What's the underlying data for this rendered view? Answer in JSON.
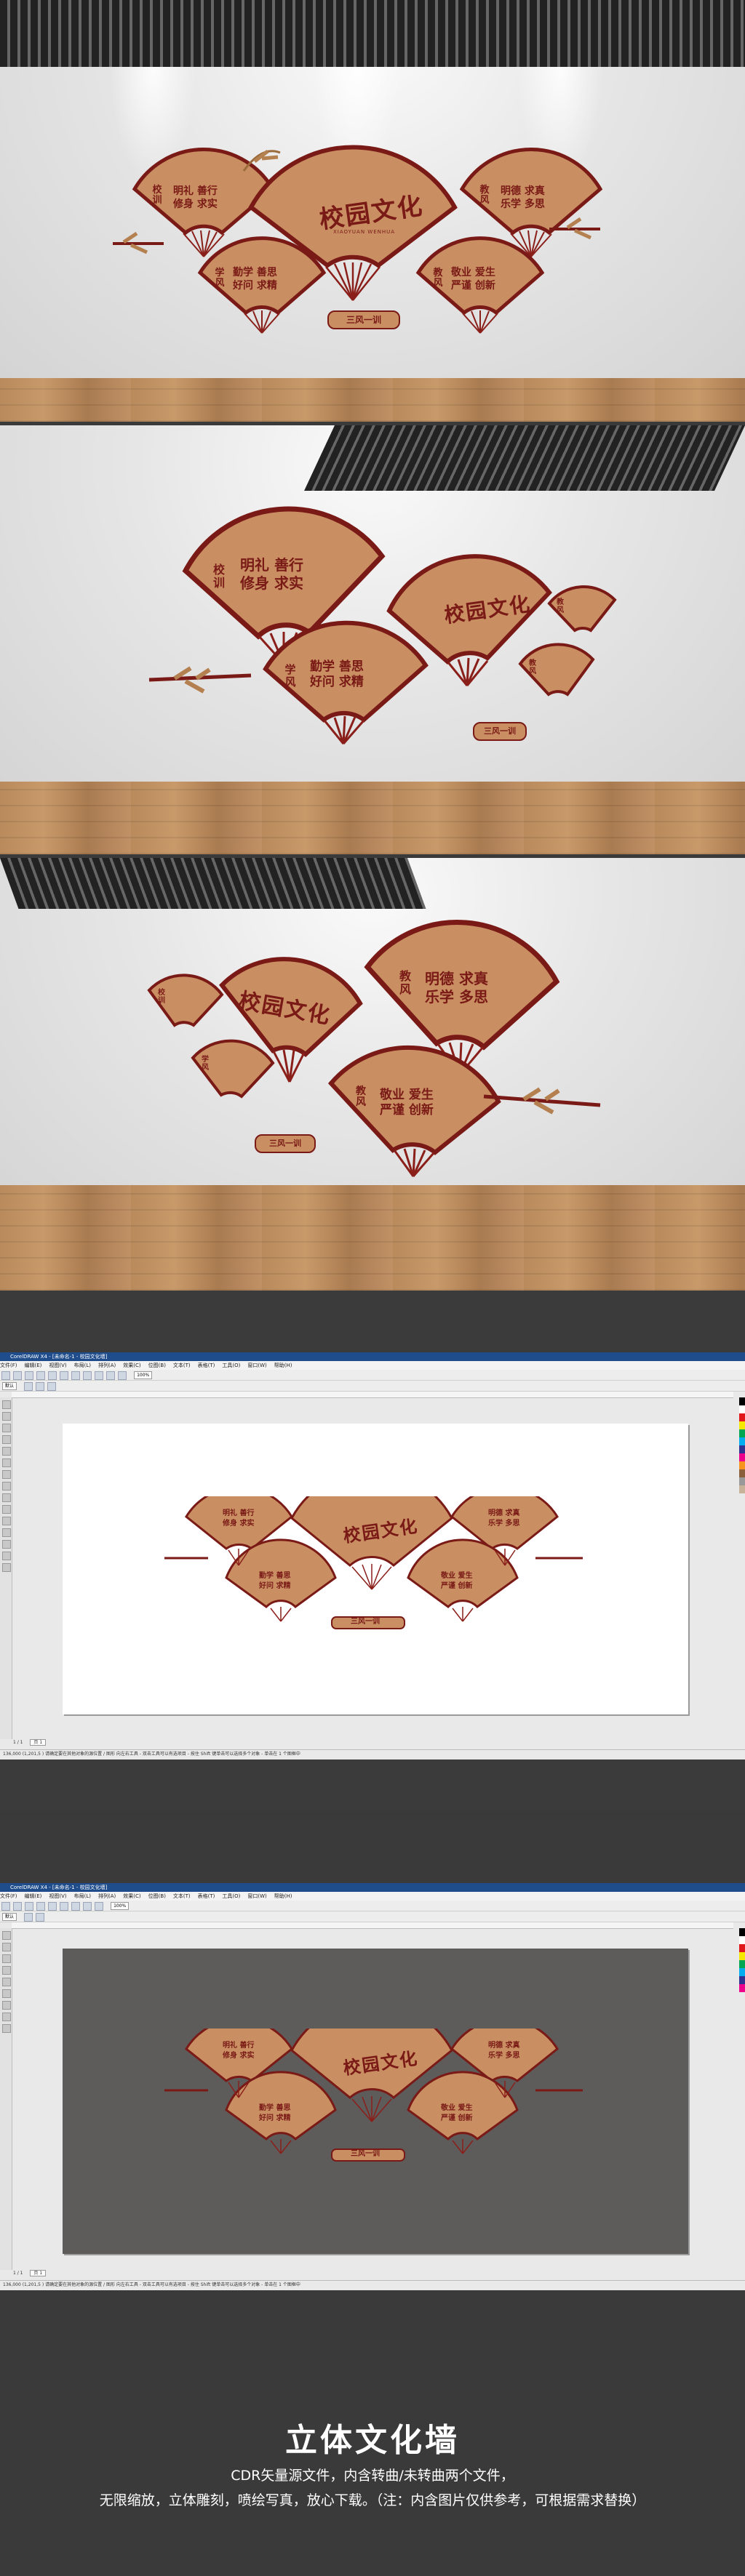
{
  "wall": {
    "title": "校园文化",
    "subtitle": "XIAOYUAN WENHUA",
    "plaque": "三风一训",
    "fans": {
      "xiaoxun": {
        "badge": [
          "校",
          "训"
        ],
        "lines": [
          "明礼 善行",
          "修身 求实"
        ]
      },
      "jiaofeng": {
        "badge": [
          "教",
          "风"
        ],
        "lines": [
          "明德 求真",
          "乐学 多思"
        ]
      },
      "xuefeng": {
        "badge": [
          "学",
          "风"
        ],
        "lines": [
          "勤学 善思",
          "好问 求精"
        ]
      },
      "jiaofeng2": {
        "badge": [
          "教",
          "风"
        ],
        "lines": [
          "敬业 爱生",
          "严谨 创新"
        ]
      }
    }
  },
  "editor": {
    "title": "CorelDRAW X4 - [未命名-1 - 校园文化墙]",
    "menu": [
      "文件(F)",
      "编辑(E)",
      "视图(V)",
      "布局(L)",
      "排列(A)",
      "效果(C)",
      "位图(B)",
      "文本(T)",
      "表格(T)",
      "工具(O)",
      "窗口(W)",
      "帮助(H)"
    ],
    "zoom": "100%",
    "style_value": "默认",
    "page_tab": "页 1",
    "page_counter": "1 / 1",
    "status": "136,000 (1,201,5 ) 请确定要在其他对象的源位置 / 图形 向左右工具 - 双击工具可以有选项目 - 按住 Shift 键单击可以选择多个对象 - 单击在 1 个图框中"
  },
  "footer": {
    "title": "立体文化墙",
    "line1": "CDR矢量源文件，内含转曲/未转曲两个文件，",
    "line2": "无限缩放，立体雕刻，喷绘写真，放心下载。（注：内含图片仅供参考，可根据需求替换）"
  },
  "colors": {
    "fan_face": "#c98f63",
    "fan_border": "#7a1a16",
    "fan_rib": "#8a1f1a",
    "background": "#3a3a3a"
  }
}
